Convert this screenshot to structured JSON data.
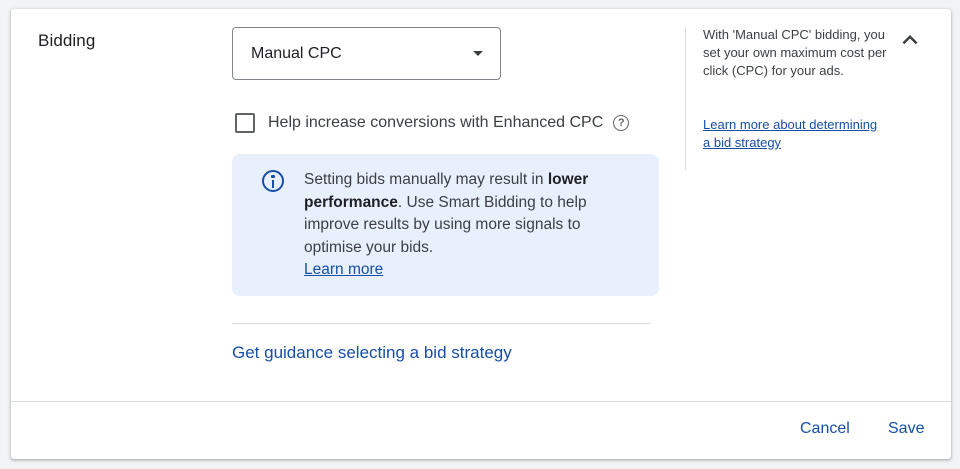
{
  "section": {
    "title": "Bidding"
  },
  "bid_strategy": {
    "selected": "Manual CPC"
  },
  "enhanced_cpc": {
    "label": "Help increase conversions with Enhanced CPC",
    "checked": false,
    "help_icon_glyph": "?"
  },
  "info": {
    "text_before": "Setting bids manually may result in ",
    "text_bold": "lower performance",
    "text_after": ". Use Smart Bidding to help improve results by using more signals to optimise your bids.",
    "learn_more": "Learn more",
    "accent_color": "#174ea6",
    "background_color": "#e8f0fe"
  },
  "guidance_link": "Get guidance selecting a bid strategy",
  "side_panel": {
    "description": "With 'Manual CPC' bidding, you set your own maximum cost per click (CPC) for your ads.",
    "link": "Learn more about determining a bid strategy"
  },
  "footer": {
    "cancel": "Cancel",
    "save": "Save"
  },
  "icons": {
    "dropdown": "caret-down-icon",
    "help": "help-circle-icon",
    "info": "info-icon",
    "collapse": "chevron-up-icon"
  }
}
